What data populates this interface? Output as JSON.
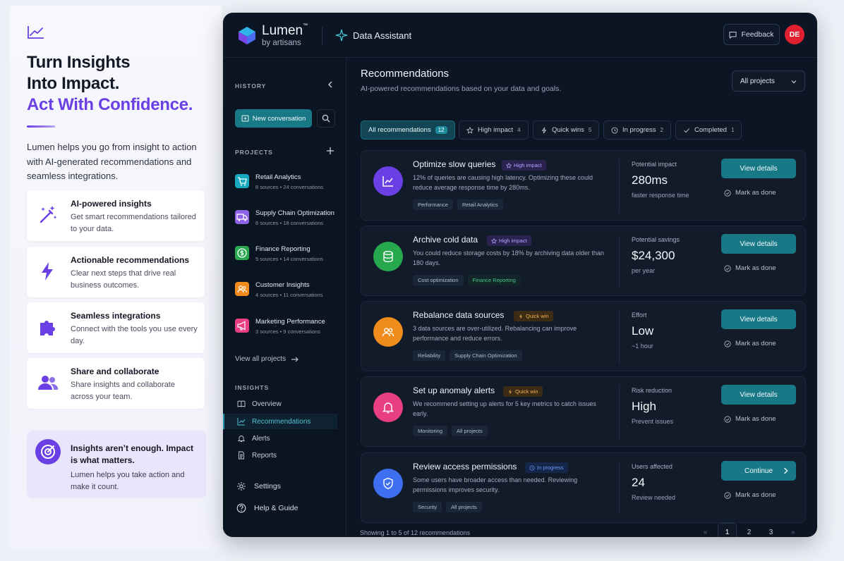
{
  "marketing": {
    "headline_line1": "Turn Insights",
    "headline_line2": "Into Impact.",
    "headline_accent": "Act With Confidence.",
    "intro": "Lumen helps you go from insight to action with AI-generated recommendations and seamless integrations.",
    "features": [
      {
        "title": "AI-powered insights",
        "desc": "Get smart recommendations tailored to your data.",
        "icon": "magic-wand-icon"
      },
      {
        "title": "Actionable recommendations",
        "desc": "Clear next steps that drive real business outcomes.",
        "icon": "lightning-icon"
      },
      {
        "title": "Seamless integrations",
        "desc": "Connect with the tools you use every day.",
        "icon": "puzzle-icon"
      },
      {
        "title": "Share and collaborate",
        "desc": "Share insights and collaborate across your team.",
        "icon": "users-icon"
      }
    ],
    "quote_title": "Insights aren’t enough. Impact is what matters.",
    "quote_desc": "Lumen helps you take action and make it count."
  },
  "app": {
    "brand": "Lumen",
    "brand_tm": "™",
    "brand_sub": "by artisans",
    "assistant_title": "Data Assistant",
    "feedback_label": "Feedback",
    "avatar_initials": "DE",
    "accent_color": "#197886"
  },
  "sidebar": {
    "history_label": "HISTORY",
    "new_conversation": "New conversation",
    "projects_label": "PROJECTS",
    "projects": [
      {
        "name": "Retail Analytics",
        "meta": "8 sources • 24 conversations",
        "color": "#15a8c0",
        "icon": "cart-icon"
      },
      {
        "name": "Supply Chain Optimization",
        "meta": "6 sources • 18 conversations",
        "color": "#8e63e8",
        "icon": "truck-icon"
      },
      {
        "name": "Finance Reporting",
        "meta": "5 sources • 14 conversations",
        "color": "#27a84f",
        "icon": "dollar-icon"
      },
      {
        "name": "Customer Insights",
        "meta": "4 sources • 11 conversations",
        "color": "#f08c1c",
        "icon": "people-icon"
      },
      {
        "name": "Marketing Performance",
        "meta": "3 sources • 9 conversations",
        "color": "#e83e82",
        "icon": "megaphone-icon"
      }
    ],
    "view_all": "View all projects",
    "insights_label": "INSIGHTS",
    "nav": [
      {
        "label": "Overview",
        "icon": "book-icon"
      },
      {
        "label": "Recommendations",
        "icon": "chart-icon"
      },
      {
        "label": "Alerts",
        "icon": "bell-icon"
      },
      {
        "label": "Reports",
        "icon": "document-icon"
      }
    ],
    "settings": "Settings",
    "help": "Help & Guide"
  },
  "main": {
    "title": "Recommendations",
    "subtitle": "AI-powered recommendations based on your data and goals.",
    "project_select": "All projects",
    "filters": [
      {
        "label": "All recommendations",
        "count": "12"
      },
      {
        "label": "High impact",
        "count": "4"
      },
      {
        "label": "Quick wins",
        "count": "5"
      },
      {
        "label": "In progress",
        "count": "2"
      },
      {
        "label": "Completed",
        "count": "1"
      }
    ],
    "cards": [
      {
        "title": "Optimize slow queries",
        "tag": "High impact",
        "desc": "12% of queries are causing high latency. Optimizing these could reduce average response time by 280ms.",
        "chips": [
          "Performance",
          "Retail Analytics"
        ],
        "metric_label": "Potential impact",
        "metric_value": "280ms",
        "metric_sub": "faster response time",
        "button": "View details",
        "mark": "Mark as done",
        "color": "#6a3fe4"
      },
      {
        "title": "Archive cold data",
        "tag": "High impact",
        "desc": "You could reduce storage costs by 18% by archiving data older than 180 days.",
        "chips": [
          "Cost optimization",
          "Finance Reporting"
        ],
        "metric_label": "Potential savings",
        "metric_value": "$24,300",
        "metric_sub": "per year",
        "button": "View details",
        "mark": "Mark as done",
        "color": "#27a84f"
      },
      {
        "title": "Rebalance data sources",
        "tag": "Quick win",
        "desc": "3 data sources are over-utilized. Rebalancing can improve performance and reduce errors.",
        "chips": [
          "Reliability",
          "Supply Chain Optimization"
        ],
        "metric_label": "Effort",
        "metric_value": "Low",
        "metric_sub": "~1 hour",
        "button": "View details",
        "mark": "Mark as done",
        "color": "#f08c1c"
      },
      {
        "title": "Set up anomaly alerts",
        "tag": "Quick win",
        "desc": "We recommend setting up alerts for 5 key metrics to catch issues early.",
        "chips": [
          "Monitoring",
          "All projects"
        ],
        "metric_label": "Risk reduction",
        "metric_value": "High",
        "metric_sub": "Prevent issues",
        "button": "View details",
        "mark": "Mark as done",
        "color": "#e83e82"
      },
      {
        "title": "Review access permissions",
        "tag": "In progress",
        "desc": "Some users have broader access than needed. Reviewing permissions improves security.",
        "chips": [
          "Security",
          "All projects"
        ],
        "metric_label": "Users affected",
        "metric_value": "24",
        "metric_sub": "Review needed",
        "button": "Continue",
        "mark": "Mark as done",
        "color": "#3d6ff0"
      }
    ],
    "showing": "Showing 1 to 5 of 12 recommendations",
    "pages": [
      "1",
      "2",
      "3"
    ],
    "prev": "«",
    "next": "»"
  }
}
